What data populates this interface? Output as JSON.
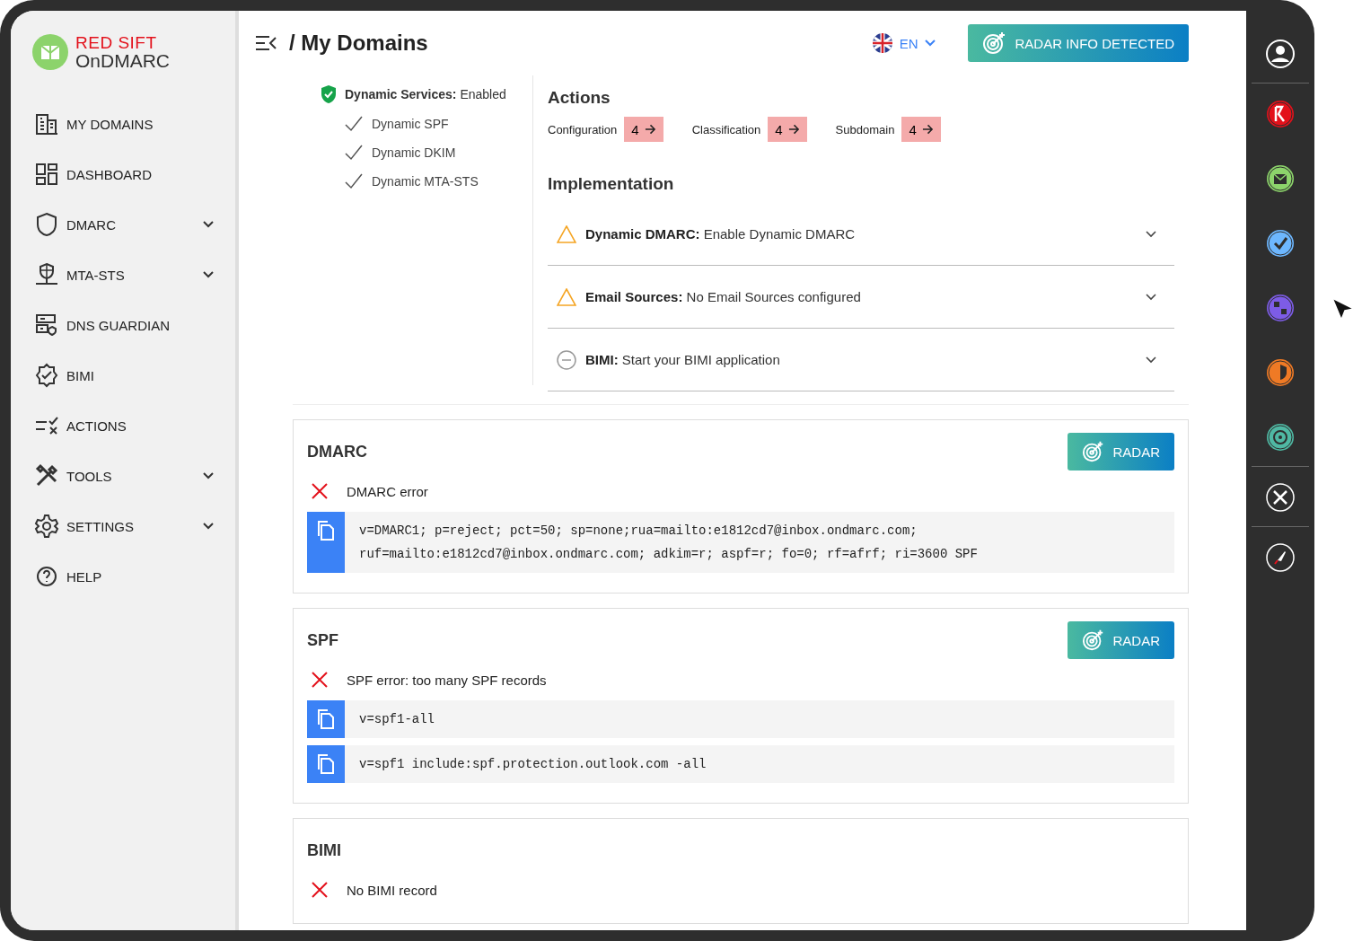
{
  "brand": {
    "line1": "RED SIFT",
    "line2": "OnDMARC"
  },
  "sidebar": {
    "items": [
      {
        "label": "MY DOMAINS",
        "submenu": false
      },
      {
        "label": "DASHBOARD",
        "submenu": false
      },
      {
        "label": "DMARC",
        "submenu": true
      },
      {
        "label": "MTA-STS",
        "submenu": true
      },
      {
        "label": "DNS GUARDIAN",
        "submenu": false
      },
      {
        "label": "BIMI",
        "submenu": false
      },
      {
        "label": "ACTIONS",
        "submenu": false
      },
      {
        "label": "TOOLS",
        "submenu": true
      },
      {
        "label": "SETTINGS",
        "submenu": true
      },
      {
        "label": "HELP",
        "submenu": false
      }
    ]
  },
  "header": {
    "title": "/ My Domains",
    "language": "EN",
    "radar_button": "RADAR INFO DETECTED"
  },
  "dynamic_services": {
    "label": "Dynamic Services:",
    "status": "Enabled",
    "items": [
      "Dynamic SPF",
      "Dynamic DKIM",
      "Dynamic MTA-STS"
    ]
  },
  "actions": {
    "title": "Actions",
    "items": [
      {
        "label": "Configuration",
        "count": "4"
      },
      {
        "label": "Classification",
        "count": "4"
      },
      {
        "label": "Subdomain",
        "count": "4"
      }
    ]
  },
  "implementation": {
    "title": "Implementation",
    "items": [
      {
        "kind": "warning",
        "label": "Dynamic DMARC:",
        "text": "Enable Dynamic DMARC"
      },
      {
        "kind": "warning",
        "label": "Email Sources:",
        "text": "No Email Sources configured"
      },
      {
        "kind": "neutral",
        "label": "BIMI:",
        "text": "Start your BIMI application"
      }
    ]
  },
  "sections": [
    {
      "title": "DMARC",
      "radar": "RADAR",
      "errors": [
        "DMARC error"
      ],
      "records": [
        "v=DMARC1; p=reject; pct=50; sp=none;rua=mailto:e1812cd7@inbox.ondmarc.com; ruf=mailto:e1812cd7@inbox.ondmarc.com; adkim=r; aspf=r; fo=0; rf=afrf; ri=3600 SPF"
      ]
    },
    {
      "title": "SPF",
      "radar": "RADAR",
      "errors": [
        "SPF error: too many SPF records"
      ],
      "records": [
        "v=spf1-all",
        "v=spf1 include:spf.protection.outlook.com -all"
      ]
    },
    {
      "title": "BIMI",
      "errors": [
        "No BIMI record"
      ]
    }
  ]
}
